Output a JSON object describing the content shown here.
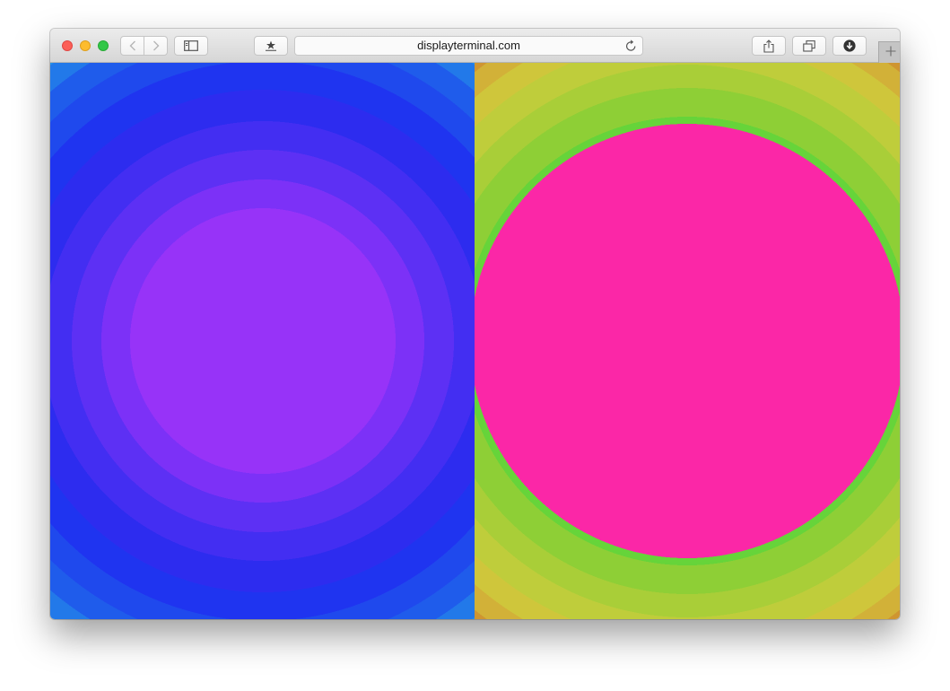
{
  "browser": {
    "address_bar": {
      "url": "displayterminal.com"
    },
    "buttons": {
      "back": "chevron-left-icon",
      "forward": "chevron-right-icon",
      "sidebar": "sidebar-icon",
      "bookmarks": "star-icon",
      "reload": "reload-icon",
      "share": "share-icon",
      "tabs": "tabs-overview-icon",
      "downloads": "download-icon",
      "new_tab": "plus-icon"
    },
    "traffic_lights": {
      "close": "#fc5f57",
      "minimize": "#fdbc2e",
      "maximize": "#33c748"
    }
  },
  "page": {
    "panels": [
      {
        "name": "left-concentric-panel",
        "center_color": "#9733f8",
        "ring_colors": [
          "#7c31f7",
          "#5d30f4",
          "#432ef2",
          "#2d2cef",
          "#1f34f0",
          "#1f49ed",
          "#1f5ceb",
          "#2279e9",
          "#2493e8",
          "#28b6e9",
          "#33d8ea",
          "#3ff0e6"
        ]
      },
      {
        "name": "right-concentric-panel",
        "center_color": "#fb27a7",
        "ring_colors": [
          "#66d43a",
          "#8ecf36",
          "#a9ce38",
          "#bfcd3b",
          "#cfc63b",
          "#d2b138",
          "#cf9531",
          "#cd7329",
          "#cb5520",
          "#c63b18"
        ]
      }
    ]
  }
}
